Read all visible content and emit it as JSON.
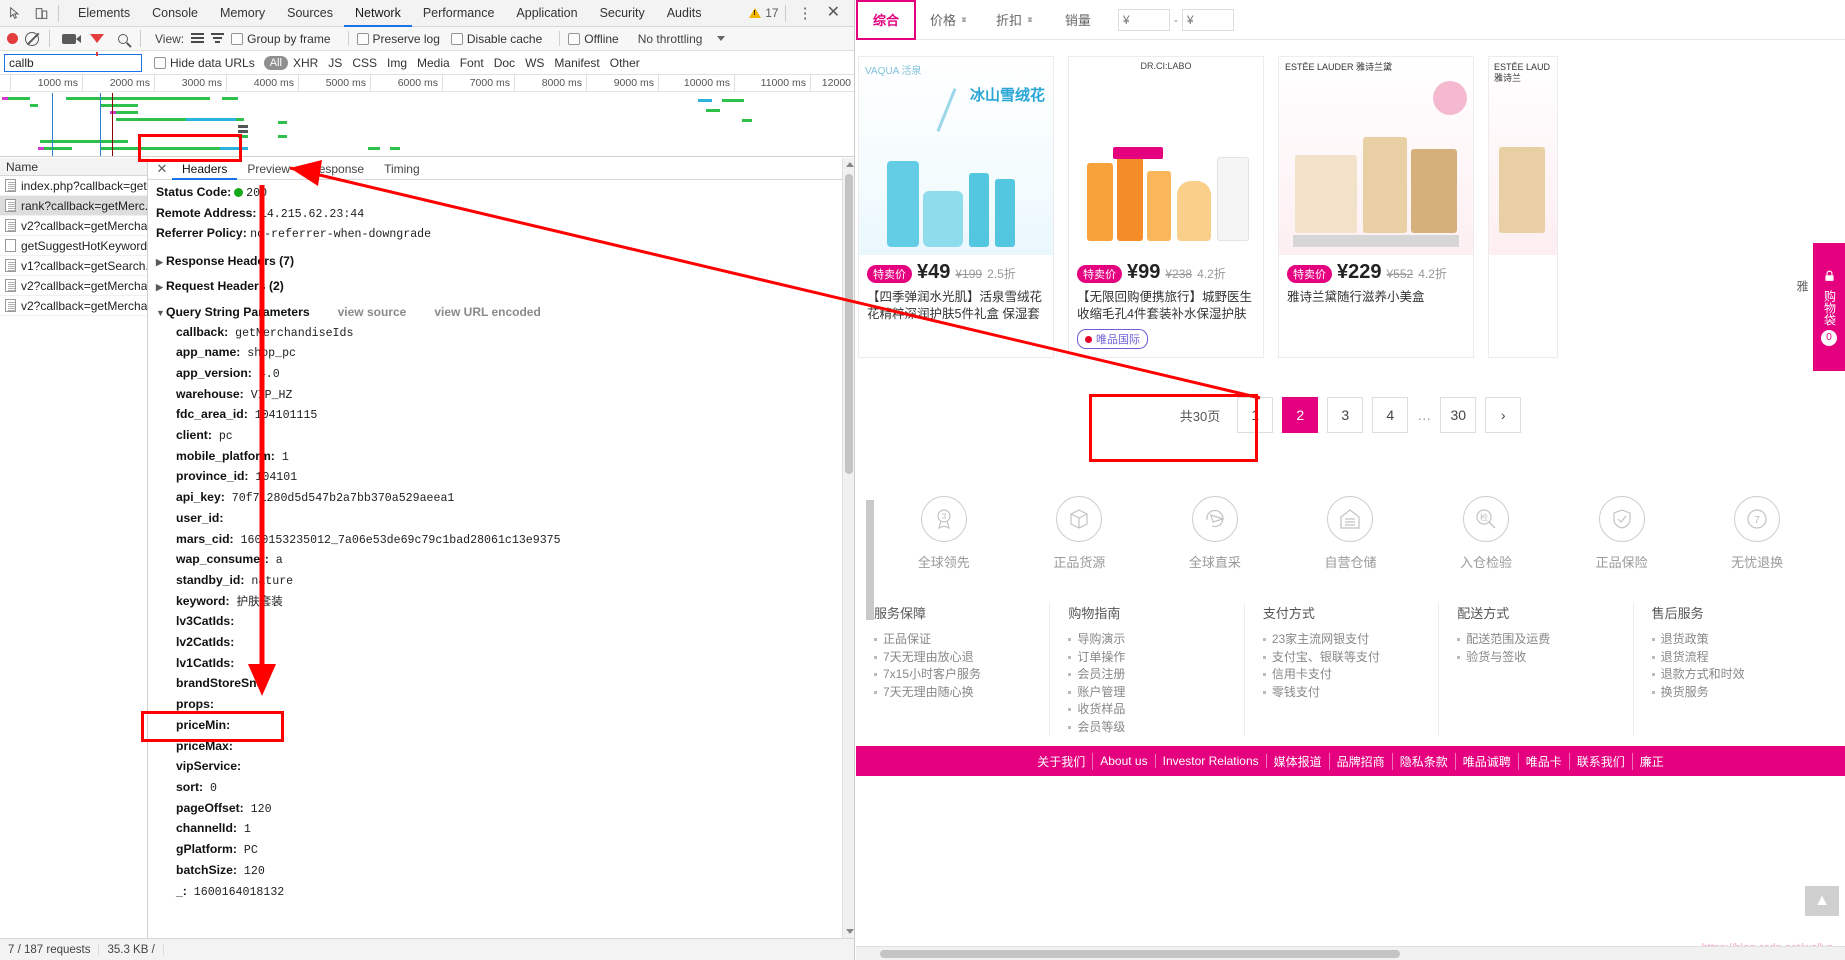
{
  "devtools": {
    "main_tabs": [
      "Elements",
      "Console",
      "Memory",
      "Sources",
      "Network",
      "Performance",
      "Application",
      "Security",
      "Audits"
    ],
    "active_main_tab": "Network",
    "warning_count": "17",
    "toolbar": {
      "view_label": "View:",
      "group_by_frame": "Group by frame",
      "preserve_log": "Preserve log",
      "disable_cache": "Disable cache",
      "offline": "Offline",
      "throttling": "No throttling"
    },
    "filter": {
      "value": "callb",
      "hide_data_urls": "Hide data URLs",
      "types": [
        "All",
        "XHR",
        "JS",
        "CSS",
        "Img",
        "Media",
        "Font",
        "Doc",
        "WS",
        "Manifest",
        "Other"
      ],
      "active_type": "All"
    },
    "timeline_ticks": [
      "1000 ms",
      "2000 ms",
      "3000 ms",
      "4000 ms",
      "5000 ms",
      "6000 ms",
      "7000 ms",
      "8000 ms",
      "9000 ms",
      "10000 ms",
      "11000 ms",
      "12000"
    ],
    "name_column_header": "Name",
    "requests": [
      {
        "name": "index.php?callback=get...",
        "selected": false,
        "icon": "document-icon"
      },
      {
        "name": "rank?callback=getMerc...",
        "selected": true,
        "icon": "document-icon"
      },
      {
        "name": "v2?callback=getMercha...",
        "selected": false,
        "icon": "document-icon"
      },
      {
        "name": "getSuggestHotKeyword...",
        "selected": false,
        "icon": "blank-document-icon"
      },
      {
        "name": "v1?callback=getSearch...",
        "selected": false,
        "icon": "document-icon"
      },
      {
        "name": "v2?callback=getMercha...",
        "selected": false,
        "icon": "document-icon"
      },
      {
        "name": "v2?callback=getMercha...",
        "selected": false,
        "icon": "document-icon"
      }
    ],
    "detail_tabs": [
      "Headers",
      "Preview",
      "Response",
      "Timing"
    ],
    "active_detail_tab": "Headers",
    "general": [
      {
        "key": "Status Code:",
        "value": "200",
        "has_dot": true
      },
      {
        "key": "Remote Address:",
        "value": "14.215.62.23:44",
        "has_dot": false
      },
      {
        "key": "Referrer Policy:",
        "value": "no-referrer-when-downgrade",
        "has_dot": false
      }
    ],
    "sections": [
      {
        "label": "Response Headers (7)",
        "expanded": false
      },
      {
        "label": "Request Headers (2)",
        "expanded": false
      }
    ],
    "query_section": {
      "label": "Query String Parameters",
      "view_source": "view source",
      "view_url_encoded": "view URL encoded"
    },
    "query_params": [
      {
        "key": "callback:",
        "value": "getMerchandiseIds"
      },
      {
        "key": "app_name:",
        "value": "shop_pc"
      },
      {
        "key": "app_version:",
        "value": "4.0"
      },
      {
        "key": "warehouse:",
        "value": "VIP_HZ"
      },
      {
        "key": "fdc_area_id:",
        "value": "104101115"
      },
      {
        "key": "client:",
        "value": "pc"
      },
      {
        "key": "mobile_platform:",
        "value": "1"
      },
      {
        "key": "province_id:",
        "value": "104101"
      },
      {
        "key": "api_key:",
        "value": "70f71280d5d547b2a7bb370a529aeea1"
      },
      {
        "key": "user_id:",
        "value": ""
      },
      {
        "key": "mars_cid:",
        "value": "1600153235012_7a06e53de69c79c1bad28061c13e9375"
      },
      {
        "key": "wap_consumer:",
        "value": "a"
      },
      {
        "key": "standby_id:",
        "value": "nature"
      },
      {
        "key": "keyword:",
        "value": "护肤套装"
      },
      {
        "key": "lv3CatIds:",
        "value": ""
      },
      {
        "key": "lv2CatIds:",
        "value": ""
      },
      {
        "key": "lv1CatIds:",
        "value": ""
      },
      {
        "key": "brandStoreSns:",
        "value": ""
      },
      {
        "key": "props:",
        "value": ""
      },
      {
        "key": "priceMin:",
        "value": ""
      },
      {
        "key": "priceMax:",
        "value": ""
      },
      {
        "key": "vipService:",
        "value": ""
      },
      {
        "key": "sort:",
        "value": "0"
      },
      {
        "key": "pageOffset:",
        "value": "120"
      },
      {
        "key": "channelId:",
        "value": "1"
      },
      {
        "key": "gPlatform:",
        "value": "PC"
      },
      {
        "key": "batchSize:",
        "value": "120"
      },
      {
        "key": "_:",
        "value": "1600164018132"
      }
    ],
    "status_bar": {
      "requests": "7 / 187 requests",
      "transferred": "35.3 KB /"
    }
  },
  "site": {
    "sort_bar": {
      "items": [
        {
          "label": "综合",
          "active": true,
          "has_arrows": false
        },
        {
          "label": "价格",
          "active": false,
          "has_arrows": true
        },
        {
          "label": "折扣",
          "active": false,
          "has_arrows": true
        },
        {
          "label": "销量",
          "active": false,
          "has_arrows": false
        }
      ],
      "price_min_placeholder": "¥",
      "price_max_placeholder": "¥",
      "price_min_value": "",
      "price_max_value": "",
      "range_dash": "-"
    },
    "products": [
      {
        "brand": "VAQUA 活泉",
        "tag": "特卖价",
        "price": "¥49",
        "original_price": "¥199",
        "discount": "2.5折",
        "title": "【四季弹润水光肌】活泉雪绒花花精粹深润护肤5件礼盒 保湿套装",
        "badge": "",
        "img_caption": "冰山雪绒花"
      },
      {
        "brand": "DR.CI:LABO",
        "tag": "特卖价",
        "price": "¥99",
        "original_price": "¥238",
        "discount": "4.2折",
        "title": "【无限回购便携旅行】城野医生收缩毛孔4件套装补水保湿护肤套装",
        "badge": "唯品国际",
        "img_caption": ""
      },
      {
        "brand": "ESTĒE LAUDER 雅诗兰黛",
        "tag": "特卖价",
        "price": "¥229",
        "original_price": "¥552",
        "discount": "4.2折",
        "title": "雅诗兰黛随行滋养小美盒",
        "badge": "",
        "img_caption": ""
      },
      {
        "brand": "ESTĒE LAUD 雅诗兰",
        "tag": "",
        "price": "",
        "original_price": "",
        "discount": "",
        "title": "",
        "badge": "",
        "img_caption": ""
      }
    ],
    "pagination": {
      "total_label": "共30页",
      "pages": [
        "1",
        "2",
        "3",
        "4"
      ],
      "ellipsis": "…",
      "last_page": "30",
      "current": "2",
      "next_icon": "chevron-right-icon"
    },
    "services": [
      {
        "label": "全球领先",
        "icon": "medal-icon"
      },
      {
        "label": "正品货源",
        "icon": "box-icon"
      },
      {
        "label": "全球直采",
        "icon": "plane-icon"
      },
      {
        "label": "自营仓储",
        "icon": "warehouse-icon"
      },
      {
        "label": "入仓检验",
        "icon": "inspect-icon"
      },
      {
        "label": "正品保险",
        "icon": "shield-icon"
      },
      {
        "label": "无忧退换",
        "icon": "return-icon"
      }
    ],
    "footer_columns": [
      {
        "title": "服务保障",
        "items": [
          "正品保证",
          "7天无理由放心退",
          "7x15小时客户服务",
          "7天无理由随心换"
        ]
      },
      {
        "title": "购物指南",
        "items": [
          "导购演示",
          "订单操作",
          "会员注册",
          "账户管理",
          "收货样品",
          "会员等级"
        ]
      },
      {
        "title": "支付方式",
        "items": [
          "23家主流网银支付",
          "支付宝、银联等支付",
          "信用卡支付",
          "零钱支付"
        ]
      },
      {
        "title": "配送方式",
        "items": [
          "配送范围及运费",
          "验货与签收"
        ]
      },
      {
        "title": "售后服务",
        "items": [
          "退货政策",
          "退货流程",
          "退款方式和时效",
          "换货服务"
        ]
      }
    ],
    "bottom_links": [
      "关于我们",
      "About us",
      "Investor Relations",
      "媒体报道",
      "品牌招商",
      "隐私条款",
      "唯品诚聘",
      "唯品卡",
      "联系我们",
      "廉正"
    ],
    "cart_rail": {
      "label": "购物袋",
      "count": "0",
      "partial_label": "雅"
    },
    "back_to_top_icon": "arrow-up-icon",
    "watermark": "https://blog.csdn.net/wallys"
  },
  "colors": {
    "brand_pink": "#e4007f",
    "devtools_accent": "#1a73e8",
    "annotation_red": "#ff0000",
    "status_green": "#17a81a"
  }
}
